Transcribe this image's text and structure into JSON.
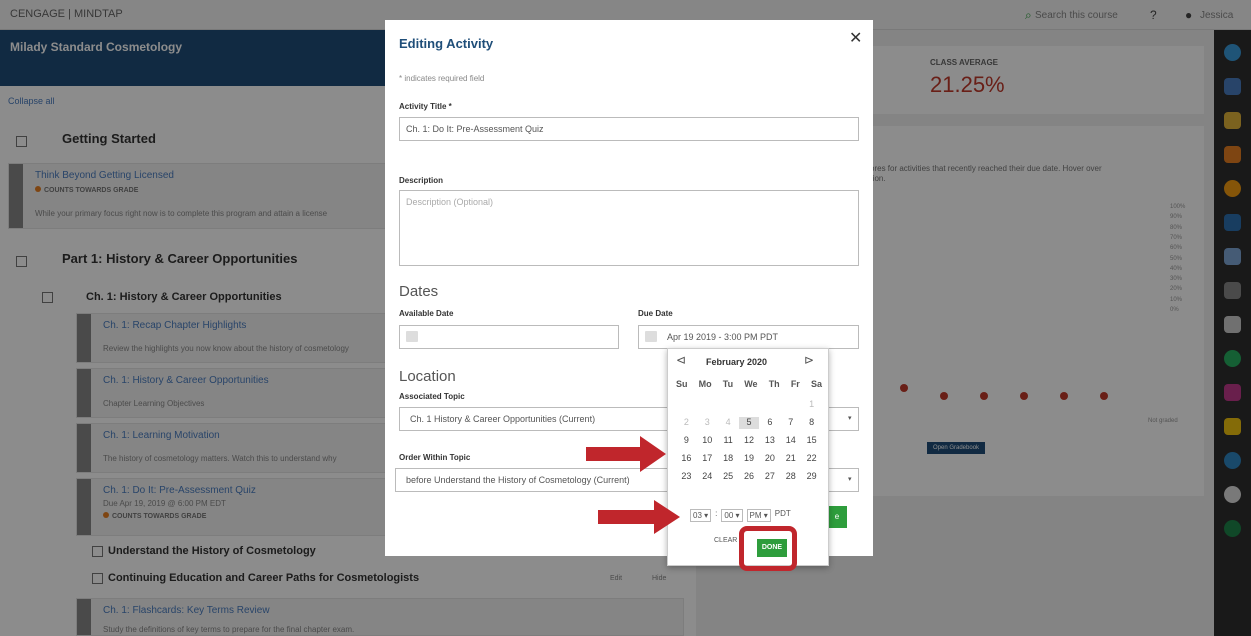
{
  "topbar": {
    "brand": "CENGAGE | MINDTAP",
    "search": "Search this course",
    "user": "Jessica"
  },
  "course": {
    "title": "Milady Standard Cosmetology",
    "collapse": "Collapse all"
  },
  "left": {
    "getting_started": "Getting Started",
    "think_beyond": "Think Beyond Getting Licensed",
    "counts": "COUNTS TOWARDS GRADE",
    "think_desc": "While your primary focus right now is to complete this program and attain a license",
    "part1": "Part 1: History & Career Opportunities",
    "ch1": "Ch. 1: History & Career Opportunities",
    "items": [
      {
        "title": "Ch. 1: Recap Chapter Highlights",
        "desc": "Review the highlights you now know about the history of cosmetology"
      },
      {
        "title": "Ch. 1: History & Career Opportunities",
        "desc": "Chapter Learning Objectives"
      },
      {
        "title": "Ch. 1: Learning Motivation",
        "desc": "The history of cosmetology matters. Watch this to understand why"
      },
      {
        "title": "Ch. 1: Do It: Pre-Assessment Quiz",
        "desc": "Due Apr 19, 2019 @ 6:00 PM EDT"
      }
    ],
    "understand": "Understand the History of Cosmetology",
    "continuing": "Continuing Education and Career Paths for Cosmetologists",
    "flashcards": "Ch. 1: Flashcards: Key Terms Review",
    "flash_desc": "Study the definitions of key terms to prepare for the final chapter exam.",
    "edit": "Edit",
    "hide": "Hide"
  },
  "right": {
    "class_avg_label": "CLASS AVERAGE",
    "class_avg": "21.25%",
    "chart_text": "cores for activities that recently reached their due date. Hover over",
    "chart_text2": "ation.",
    "yticks": [
      "100%",
      "90%",
      "80%",
      "70%",
      "60%",
      "50%",
      "40%",
      "30%",
      "20%",
      "10%",
      "0%"
    ],
    "not_graded": "Not graded",
    "open_gradebook": "Open Gradebook"
  },
  "modal": {
    "title": "Editing Activity",
    "required": "* indicates required field",
    "activity_title_label": "Activity Title *",
    "activity_title_value": "Ch. 1: Do It: Pre-Assessment Quiz",
    "description_label": "Description",
    "description_placeholder": "Description (Optional)",
    "dates_heading": "Dates",
    "available_label": "Available Date",
    "due_label": "Due Date",
    "due_value": "Apr 19 2019 - 3:00 PM PDT",
    "location_heading": "Location",
    "assoc_topic_label": "Associated Topic",
    "assoc_topic_value": "Ch. 1 History & Career Opportunities (Current)",
    "order_label": "Order Within Topic",
    "order_value": "before Understand the History of Cosmetology (Current)",
    "save_label": "e"
  },
  "datepicker": {
    "month": "February 2020",
    "dow": [
      "Su",
      "Mo",
      "Tu",
      "We",
      "Th",
      "Fr",
      "Sa"
    ],
    "days": [
      [
        "",
        "",
        "",
        "",
        "",
        "",
        "1"
      ],
      [
        "2",
        "3",
        "4",
        "5",
        "6",
        "7",
        "8"
      ],
      [
        "9",
        "10",
        "11",
        "12",
        "13",
        "14",
        "15"
      ],
      [
        "16",
        "17",
        "18",
        "19",
        "20",
        "21",
        "22"
      ],
      [
        "23",
        "24",
        "25",
        "26",
        "27",
        "28",
        "29"
      ]
    ],
    "today": "5",
    "hour": "03",
    "minute": "00",
    "ampm": "PM",
    "tz": "PDT",
    "clear": "CLEAR",
    "done": "DONE"
  },
  "colors": {
    "accent": "#1f4e79",
    "done": "#2e9d3c",
    "highlight": "#c0262c"
  }
}
